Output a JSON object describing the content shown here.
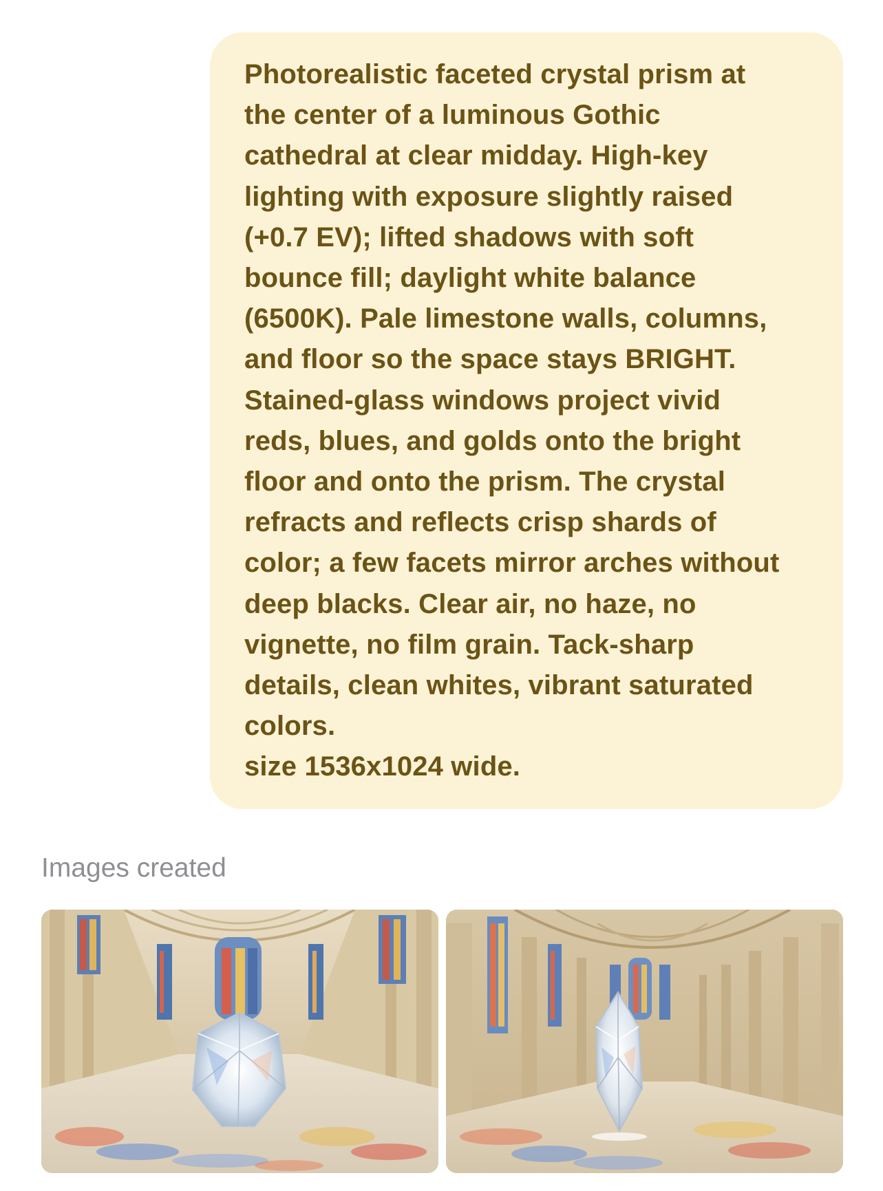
{
  "prompt": {
    "text": "Photorealistic faceted crystal prism at\nthe center of a luminous Gothic\ncathedral at clear midday. High-key\nlighting with exposure slightly raised\n(+0.7 EV); lifted shadows with soft\nbounce fill; daylight white balance\n(6500K). Pale limestone walls, columns,\nand floor so the space stays BRIGHT.\nStained-glass windows project vivid\nreds, blues, and golds onto the bright\nfloor and onto the prism. The crystal\nrefracts and reflects crisp shards of\ncolor; a few facets mirror arches without\ndeep blacks. Clear air, no haze, no\nvignette, no film grain. Tack-sharp\ndetails, clean whites, vibrant saturated\ncolors.\nsize 1536x1024 wide."
  },
  "images_section": {
    "label": "Images created",
    "images": [
      {
        "name": "generated-image-1"
      },
      {
        "name": "generated-image-2"
      }
    ]
  },
  "colors": {
    "bubble_bg": "#fcf3d6",
    "bubble_text": "#6b5316",
    "label_gray": "#8e8e93"
  }
}
